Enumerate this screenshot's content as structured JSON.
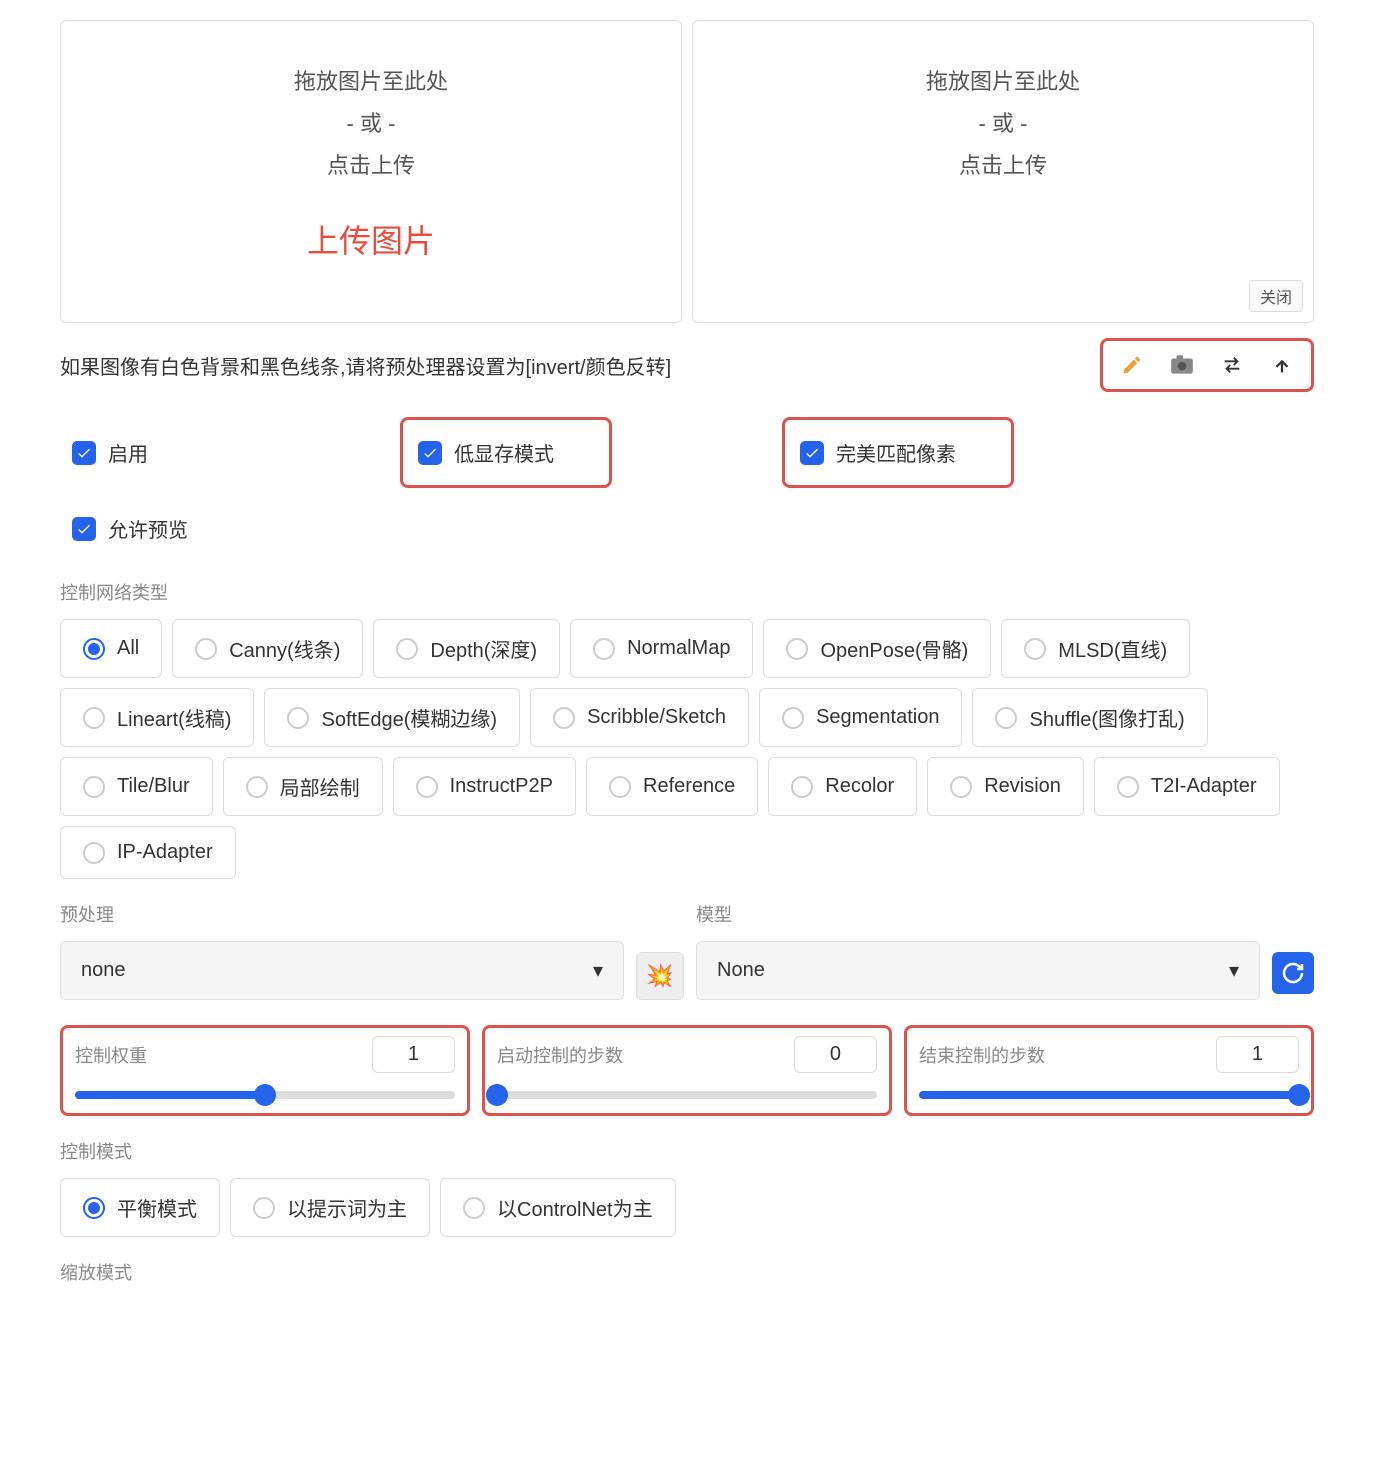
{
  "upload": {
    "drag_text": "拖放图片至此处",
    "or_text": "- 或 -",
    "click_text": "点击上传",
    "caption": "上传图片",
    "close": "关闭"
  },
  "info_text": "如果图像有白色背景和黑色线条,请将预处理器设置为[invert/颜色反转]",
  "checkboxes": {
    "enable": "启用",
    "low_vram": "低显存模式",
    "pixel_perfect": "完美匹配像素",
    "allow_preview": "允许预览"
  },
  "control_type": {
    "label": "控制网络类型",
    "options": [
      "All",
      "Canny(线条)",
      "Depth(深度)",
      "NormalMap",
      "OpenPose(骨骼)",
      "MLSD(直线)",
      "Lineart(线稿)",
      "SoftEdge(模糊边缘)",
      "Scribble/Sketch",
      "Segmentation",
      "Shuffle(图像打乱)",
      "Tile/Blur",
      "局部绘制",
      "InstructP2P",
      "Reference",
      "Recolor",
      "Revision",
      "T2I-Adapter",
      "IP-Adapter"
    ],
    "selected": 0
  },
  "preprocessor": {
    "label": "预处理",
    "value": "none"
  },
  "model": {
    "label": "模型",
    "value": "None"
  },
  "sliders": {
    "weight": {
      "label": "控制权重",
      "value": "1",
      "fill": 50
    },
    "start": {
      "label": "启动控制的步数",
      "value": "0",
      "fill": 0
    },
    "end": {
      "label": "结束控制的步数",
      "value": "1",
      "fill": 100
    }
  },
  "control_mode": {
    "label": "控制模式",
    "options": [
      "平衡模式",
      "以提示词为主",
      "以ControlNet为主"
    ],
    "selected": 0
  },
  "resize_mode": {
    "label": "缩放模式"
  }
}
